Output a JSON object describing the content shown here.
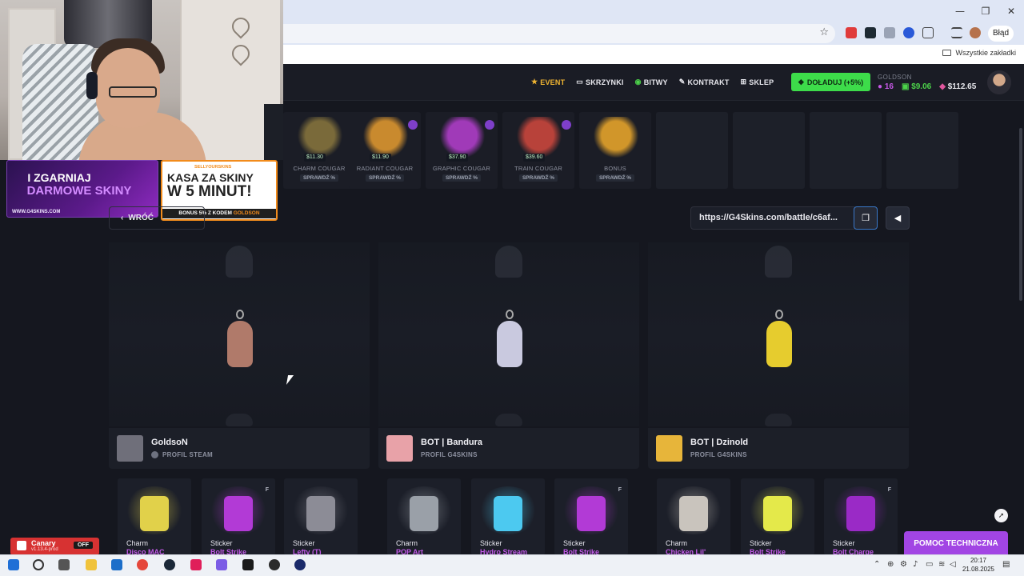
{
  "browser": {
    "error_button": "Błąd",
    "all_bookmarks": "Wszystkie zakładki"
  },
  "site_nav": {
    "event": "EVENT",
    "cases": "SKRZYNKI",
    "battles": "BITWY",
    "contract": "KONTRAKT",
    "shop": "SKLEP",
    "topup": "DOŁADUJ (+5%)"
  },
  "user": {
    "name": "GOLDSON",
    "level": "16",
    "balance_green": "$9.06",
    "balance_pink": "$112.65"
  },
  "case_strip": {
    "check_label": "SPRAWDŹ %",
    "cases": [
      {
        "name": "CHARM COUGAR",
        "price": "$11.30",
        "color": "#7a6a3a"
      },
      {
        "name": "RADIANT COUGAR",
        "price": "$11.90",
        "color": "#c98a2e"
      },
      {
        "name": "GRAPHIC COUGAR",
        "price": "$37.90",
        "color": "#a03ab8"
      },
      {
        "name": "TRAIN COUGAR",
        "price": "$39.60",
        "color": "#b8423a"
      },
      {
        "name": "BONUS",
        "price": "",
        "color": "#d1962a"
      }
    ]
  },
  "ads": {
    "ad1_line1": "I ZGARNIAJ",
    "ad1_line2": "DARMOWE SKINY",
    "ad1_url": "WWW.G4SKINS.COM",
    "ad2_brand": "SELLYOURSKINS",
    "ad2_line1": "KASA ZA SKINY",
    "ad2_line2": "W 5 MINUT!",
    "ad2_bonus": "BONUS 5% Z KODEM",
    "ad2_code": "GOLDSON"
  },
  "battle": {
    "back_label": "WRÓĆ",
    "link": "https://G4Skins.com/battle/c6af...",
    "players": [
      {
        "name": "GoldsoN",
        "sub": "PROFIL STEAM",
        "charm_color": "#b07a6a",
        "avatar_color": "#6f6f7a"
      },
      {
        "name": "BOT | Bandura",
        "sub": "PROFIL G4SKINS",
        "charm_color": "#c9c9df",
        "avatar_color": "#e8a2a8"
      },
      {
        "name": "BOT | Dzinold",
        "sub": "PROFIL G4SKINS",
        "charm_color": "#e6cc2e",
        "avatar_color": "#e7b53a"
      }
    ]
  },
  "drops": [
    {
      "type": "Charm",
      "name": "Disco MAC",
      "flag": "",
      "color": "#e1d14a"
    },
    {
      "type": "Sticker",
      "name": "Bolt Strike",
      "flag": "F",
      "color": "#b23ad6"
    },
    {
      "type": "Sticker",
      "name": "Lefty (T)",
      "flag": "",
      "color": "#8c8c96"
    },
    {
      "type": "Charm",
      "name": "POP Art",
      "flag": "",
      "color": "#9aa0a8"
    },
    {
      "type": "Sticker",
      "name": "Hydro Stream",
      "flag": "",
      "color": "#4cc9f0"
    },
    {
      "type": "Sticker",
      "name": "Bolt Strike",
      "flag": "F",
      "color": "#b23ad6"
    },
    {
      "type": "Charm",
      "name": "Chicken Lil'",
      "flag": "",
      "color": "#c9c4bd"
    },
    {
      "type": "Sticker",
      "name": "Bolt Strike",
      "flag": "",
      "color": "#e4e94a"
    },
    {
      "type": "Sticker",
      "name": "Bolt Charge",
      "flag": "F",
      "color": "#9a2ac6"
    }
  ],
  "canary": {
    "title": "Canary",
    "version": "v1.13.4-prod",
    "state": "OFF"
  },
  "help_label": "POMOC TECHNICZNA",
  "clock": {
    "time": "20:17",
    "date": "21.08.2025"
  }
}
